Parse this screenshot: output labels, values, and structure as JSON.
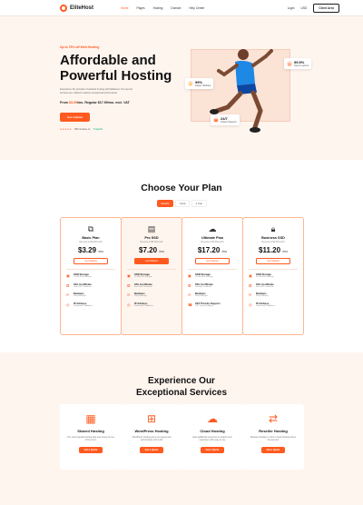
{
  "nav": {
    "brand": "EliteHost",
    "menu": [
      "Home",
      "Pages",
      "Hosting",
      "Domain",
      "Help Center"
    ],
    "login": "Login",
    "currency": "USD",
    "cta": "Client Area"
  },
  "hero": {
    "promo": "Up to 75% off Web Hosting",
    "title": "Affordable and Powerful Hosting",
    "description": "Experience the pinnacle of website hosting with EliteHost. Our top-tier services are crafted to deliver exceptional performance.",
    "price_prefix": "From",
    "price_amount": "$3.99",
    "price_suffix": "/mo. Regular $17.99/mo. excl. VAT",
    "cta": "Get a Quote",
    "stars": "★★★★★",
    "reviews": "952 reviews on",
    "trustpilot": "Trustpilot",
    "stats": [
      {
        "value": "99%",
        "label": "Faster Website"
      },
      {
        "value": "99.5%",
        "label": "Server uptime"
      },
      {
        "value": "24/7",
        "label": "Instant Support"
      }
    ]
  },
  "plans": {
    "title": "Choose Your Plan",
    "toggle": [
      "Monthly",
      "Yearly",
      "2 Year"
    ],
    "items": [
      {
        "icon": "network-icon",
        "name": "Basic Plan",
        "renew": "Renews at $3.29/month",
        "price": "$3.29",
        "unit": "/mo",
        "cta": "Get Started",
        "features": [
          [
            "SSD Storage",
            "75 GB SSD Storage"
          ],
          [
            "SSL Certificate",
            "Free SSL Certificate"
          ],
          [
            "Backups",
            "Daily Backups"
          ],
          [
            "IP Address",
            "Dedicated IP Address"
          ]
        ]
      },
      {
        "icon": "server-icon",
        "name": "Pro SSD",
        "renew": "Renews at $5.53/month",
        "price": "$7.20",
        "unit": "/mo",
        "cta": "Get Started",
        "features": [
          [
            "SSD Storage",
            "10 GB SSD Storage"
          ],
          [
            "SSL Certificate",
            "Free SSL Certificate"
          ],
          [
            "Backups",
            "Daily Backups"
          ],
          [
            "IP Address",
            "Dedicated IP Address"
          ]
        ]
      },
      {
        "icon": "cloud-icon",
        "name": "Ultimate Plan",
        "renew": "Renews at $2.53/month",
        "price": "$17.20",
        "unit": "/mo",
        "cta": "Get Started",
        "features": [
          [
            "SSD Storage",
            "20 GB SSD Storage"
          ],
          [
            "SSL Certificate",
            "Friendly Certificate"
          ],
          [
            "Backups",
            "Daily Backups"
          ],
          [
            "24/7 Priority Support",
            "24/7 Priority Support"
          ]
        ]
      },
      {
        "icon": "lock-icon",
        "name": "Business SSD",
        "renew": "Renews at $3.53/month",
        "price": "$11.20",
        "unit": "/mo",
        "cta": "Get Started",
        "features": [
          [
            "SSD Storage",
            "50 GB SSD Storage"
          ],
          [
            "SSL Certificate",
            "Free SSL Certificate"
          ],
          [
            "Backups",
            "Daily Backups"
          ],
          [
            "IP Address",
            "Dedicated IP Address"
          ]
        ]
      }
    ]
  },
  "services": {
    "title_line1": "Experience Our",
    "title_line2": "Exceptional Services",
    "items": [
      {
        "icon": "shared-hosting-icon",
        "name": "Shared Hosting",
        "desc": "The most popular hosting plan and comes at one of the most.",
        "cta": "Get a Quote"
      },
      {
        "icon": "wordpress-icon",
        "name": "WordPress Hosting",
        "desc": "WordPress hosting gives you speed and performance with a full",
        "cta": "Get a Quote"
      },
      {
        "icon": "cloud-icon",
        "name": "Cloud Hosting",
        "desc": "Gain additional resources to support your customers with easy to use",
        "cta": "Get a Quote"
      },
      {
        "icon": "reseller-icon",
        "name": "Reseller Hosting",
        "desc": "Reseller hosting is a form of web hosting where the account",
        "cta": "Get a Quote"
      }
    ]
  },
  "colors": {
    "accent": "#ff5a1f",
    "hero_bg": "#fff5ef"
  }
}
